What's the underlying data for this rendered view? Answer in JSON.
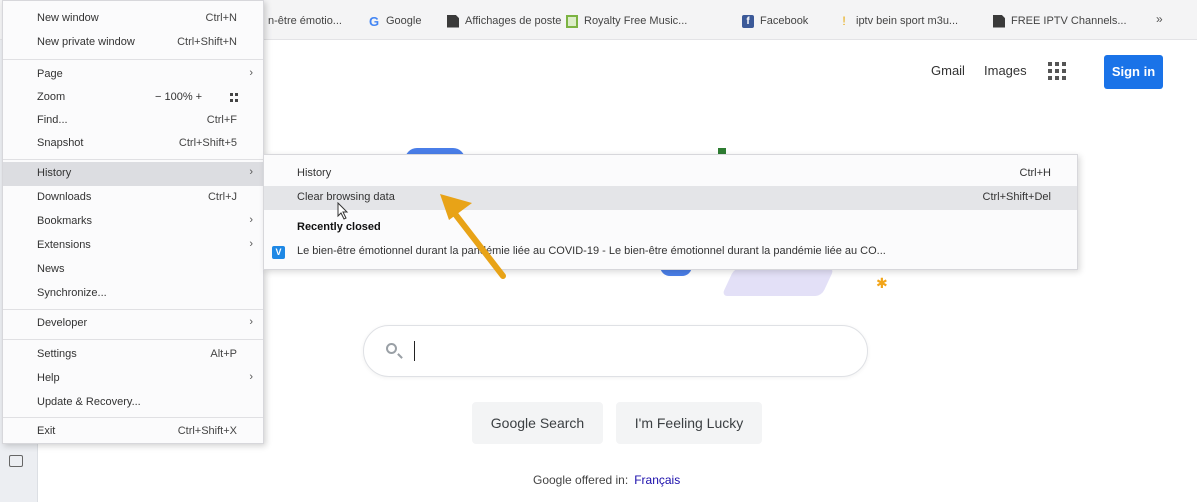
{
  "bookmarks": [
    {
      "label": "n-être émotio...",
      "icon": "document-icon"
    },
    {
      "label": "Google",
      "icon": "google-icon"
    },
    {
      "label": "Affichages de poste",
      "icon": "document-icon"
    },
    {
      "label": "Royalty Free Music...",
      "icon": "music-icon"
    },
    {
      "label": "Facebook",
      "icon": "facebook-icon"
    },
    {
      "label": "iptv bein sport m3u...",
      "icon": "iptv-icon"
    },
    {
      "label": "FREE IPTV Channels...",
      "icon": "document-icon"
    }
  ],
  "bookmarks_more": "»",
  "google": {
    "gmail": "Gmail",
    "images": "Images",
    "sign_in": "Sign in",
    "search_button": "Google Search",
    "lucky_button": "I'm Feeling Lucky",
    "offered_in": "Google offered in:",
    "language": "Français"
  },
  "menu": {
    "items": [
      {
        "label": "New window",
        "shortcut": "Ctrl+N"
      },
      {
        "label": "New private window",
        "shortcut": "Ctrl+Shift+N"
      },
      {
        "label": "Page",
        "shortcut": ""
      },
      {
        "label": "Zoom",
        "shortcut": ""
      },
      {
        "label": "Find...",
        "shortcut": "Ctrl+F"
      },
      {
        "label": "Snapshot",
        "shortcut": "Ctrl+Shift+5"
      },
      {
        "label": "History",
        "shortcut": ""
      },
      {
        "label": "Downloads",
        "shortcut": "Ctrl+J"
      },
      {
        "label": "Bookmarks",
        "shortcut": ""
      },
      {
        "label": "Extensions",
        "shortcut": ""
      },
      {
        "label": "News",
        "shortcut": ""
      },
      {
        "label": "Synchronize...",
        "shortcut": ""
      },
      {
        "label": "Developer",
        "shortcut": ""
      },
      {
        "label": "Settings",
        "shortcut": "Alt+P"
      },
      {
        "label": "Help",
        "shortcut": ""
      },
      {
        "label": "Update & Recovery...",
        "shortcut": ""
      },
      {
        "label": "Exit",
        "shortcut": "Ctrl+Shift+X"
      }
    ],
    "zoom_value": "− 100% +"
  },
  "history_submenu": {
    "history_label": "History",
    "history_shortcut": "Ctrl+H",
    "clear_label": "Clear browsing data",
    "clear_shortcut": "Ctrl+Shift+Del",
    "recently_closed": "Recently closed",
    "recent_item": "Le bien-être émotionnel durant la pandémie liée au COVID-19 - Le bien-être émotionnel durant la pandémie liée au CO..."
  },
  "colors": {
    "accent_arrow": "#e8a317",
    "sign_in_blue": "#1a73e8",
    "menu_highlight": "#dcdde1"
  }
}
